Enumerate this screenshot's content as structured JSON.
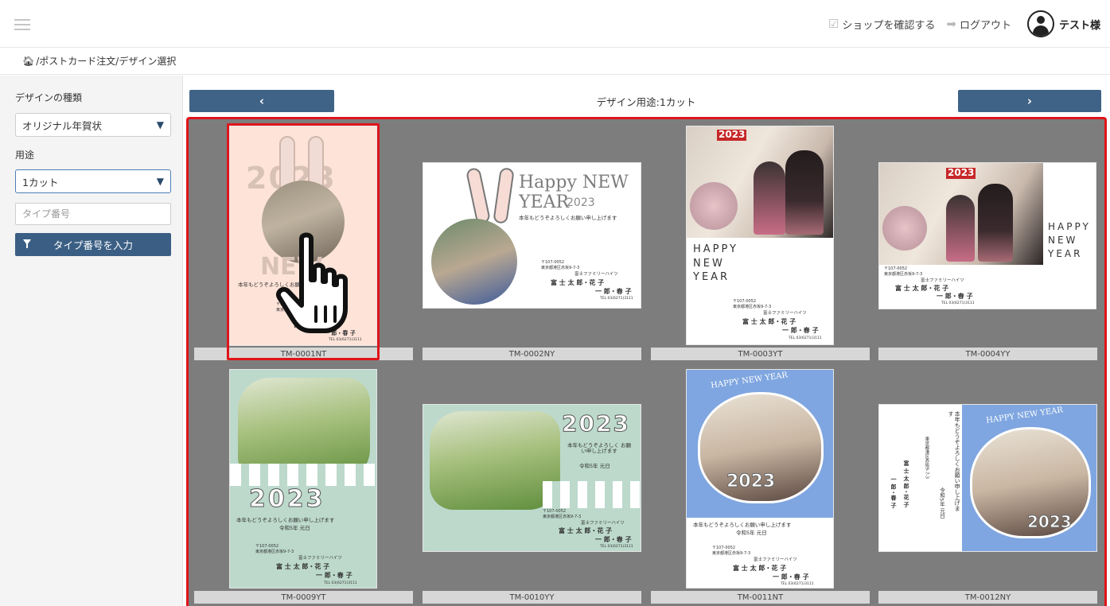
{
  "header": {
    "shop_link_label": "ショップを確認する",
    "logout_label": "ログアウト",
    "user_name": "テスト様"
  },
  "breadcrumb": {
    "items": [
      "ポストカード注文",
      "デザイン選択"
    ]
  },
  "sidebar": {
    "design_type_label": "デザインの種類",
    "design_type_value": "オリジナル年賀状",
    "usage_label": "用途",
    "usage_value": "1カット",
    "type_number_placeholder": "タイプ番号",
    "type_number_button": "タイプ番号を入力"
  },
  "main": {
    "usage_title": "デザイン用途:1カット",
    "prev_label": "‹",
    "next_label": "›"
  },
  "cards": [
    {
      "code": "TM-0001NT",
      "year": "2023",
      "message": "本年もどうぞよろしくお願い申し上げます",
      "big_text": "NEW"
    },
    {
      "code": "TM-0002NY",
      "headline": "Happy NEW YEAR",
      "year": "2023",
      "message": "本年もどうぞよろしくお願い申し上げます"
    },
    {
      "code": "TM-0003YT",
      "year": "2023",
      "greeting": [
        "HAPPY",
        "NEW",
        "YEAR"
      ]
    },
    {
      "code": "TM-0004YY",
      "year": "2023",
      "greeting": [
        "HAPPY",
        "NEW",
        "YEAR"
      ]
    },
    {
      "code": "TM-0009YT",
      "year": "2023",
      "message": "本年もどうぞよろしくお願い申し上げます",
      "era": "令和5年 元日"
    },
    {
      "code": "TM-0010YY",
      "year": "2023",
      "message": "本年もどうぞよろしく お願い申し上げます",
      "era": "令和5年 元日"
    },
    {
      "code": "TM-0011NT",
      "headline": "HAPPY NEW YEAR",
      "year": "2023",
      "message": "本年もどうぞよろしくお願い申し上げます",
      "era": "令和5年 元日"
    },
    {
      "code": "TM-0012NY",
      "headline": "HAPPY NEW YEAR",
      "year": "2023",
      "message": "本年もどうぞよろしくお願い申し上げます",
      "era": "令和5年 元日"
    }
  ],
  "sender": {
    "postal": "〒107-0052",
    "address": "東京都港区赤坂9-7-3",
    "building": "富士ファミリーハイツ",
    "name1": "富 士 太 郎・花 子",
    "name2": "一 郎・春 子",
    "tel": "TEL 03(6271)3111"
  },
  "colors": {
    "nav_button": "#3f6387",
    "selection": "#e0141b",
    "grid_bg": "#7d7d7d",
    "sidebar_bg": "#f4f4f4"
  },
  "icons": {
    "menu": "hamburger-icon",
    "shop": "checkbox-icon",
    "logout": "logout-icon",
    "user": "user-avatar-icon",
    "home": "home-icon",
    "filter": "filter-icon",
    "pointer": "hand-pointer-icon"
  }
}
